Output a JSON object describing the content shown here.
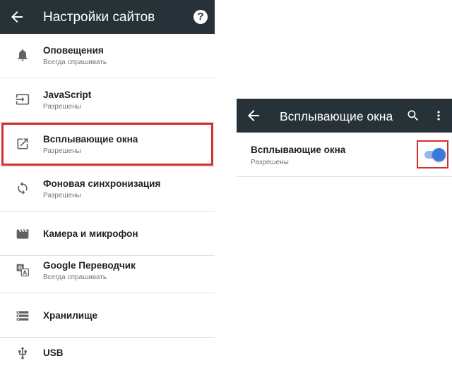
{
  "colors": {
    "toolbar": "#263238",
    "accent": "#3a79de",
    "highlight": "#d32f2f"
  },
  "left": {
    "toolbar": {
      "title": "Настройки сайтов",
      "back_icon": "arrow-back-icon",
      "help_icon": "help-icon",
      "help_glyph": "?"
    },
    "items": [
      {
        "icon": "bell-icon",
        "title": "Оповещения",
        "subtitle": "Всегда спрашивать"
      },
      {
        "icon": "input-arrow-icon",
        "title": "JavaScript",
        "subtitle": "Разрешены"
      },
      {
        "icon": "open-in-new-icon",
        "title": "Всплывающие окна",
        "subtitle": "Разрешены"
      },
      {
        "icon": "sync-icon",
        "title": "Фоновая синхронизация",
        "subtitle": "Разрешены"
      },
      {
        "icon": "camera-icon",
        "title": "Камера и микрофон"
      },
      {
        "icon": "translate-icon",
        "title": "Google Переводчик",
        "subtitle": "Всегда спрашивать"
      },
      {
        "icon": "storage-icon",
        "title": "Хранилище"
      },
      {
        "icon": "usb-icon",
        "title": "USB"
      }
    ]
  },
  "right": {
    "toolbar": {
      "title": "Всплывающие окна",
      "back_icon": "arrow-back-icon",
      "search_icon": "search-icon",
      "more_icon": "more-vert-icon"
    },
    "setting": {
      "title": "Всплывающие окна",
      "subtitle": "Разрешены",
      "toggle_on": true
    }
  }
}
